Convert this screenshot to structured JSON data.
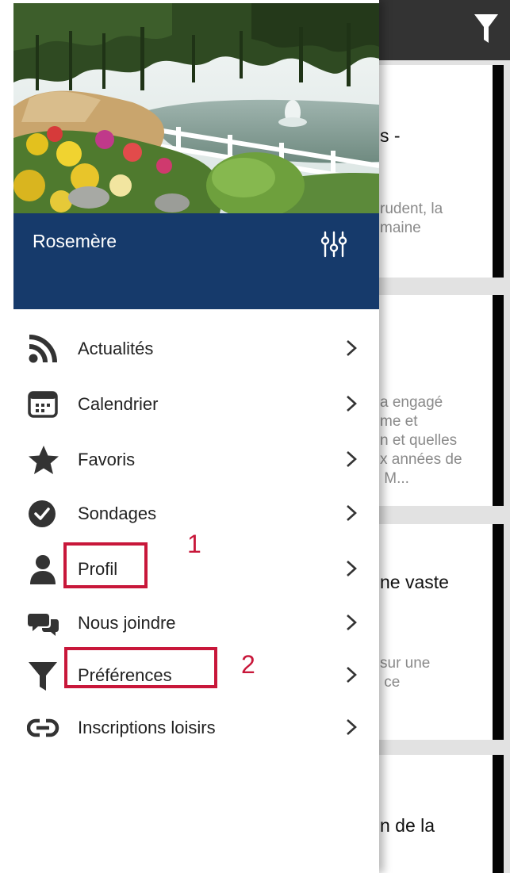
{
  "drawer": {
    "site_name": "Rosemère",
    "menu": [
      {
        "label": "Actualités",
        "icon": "rss-icon"
      },
      {
        "label": "Calendrier",
        "icon": "calendar-icon"
      },
      {
        "label": "Favoris",
        "icon": "star-icon"
      },
      {
        "label": "Sondages",
        "icon": "check-circle-icon"
      },
      {
        "label": "Profil",
        "icon": "person-icon"
      },
      {
        "label": "Nous joindre",
        "icon": "chat-bubbles-icon"
      },
      {
        "label": "Préférences",
        "icon": "filter-icon"
      },
      {
        "label": "Inscriptions loisirs",
        "icon": "link-icon"
      }
    ]
  },
  "annotations": {
    "profil_number": "1",
    "preferences_number": "2"
  },
  "feed": {
    "cards": [
      {
        "title": "s -",
        "text": "rudent, la\nmaine"
      },
      {
        "title": "",
        "text": "a engagé\nme et\nn et quelles\nx années de\n M..."
      },
      {
        "title": "ne vaste",
        "text": "sur une\n ce"
      },
      {
        "title": "n de la",
        "text": ""
      }
    ]
  },
  "colors": {
    "header_blue": "#163a6b",
    "annotation_red": "#c8173a",
    "topbar": "#333333"
  }
}
